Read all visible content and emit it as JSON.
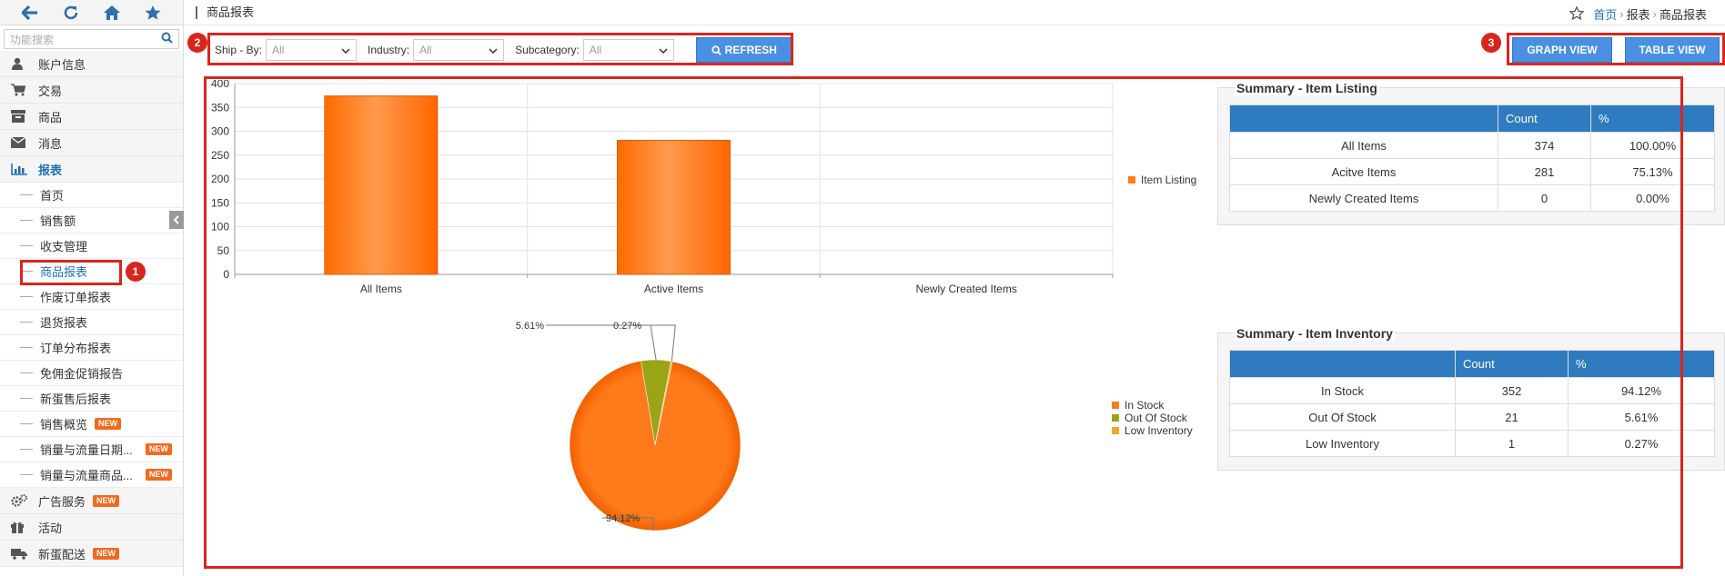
{
  "sidebar": {
    "search_placeholder": "功能搜索",
    "menu": [
      {
        "label": "账户信息",
        "icon": "user-icon"
      },
      {
        "label": "交易",
        "icon": "cart-icon"
      },
      {
        "label": "商品",
        "icon": "archive-icon"
      },
      {
        "label": "消息",
        "icon": "envelope-icon"
      },
      {
        "label": "报表",
        "icon": "bar-chart-icon"
      }
    ],
    "submenu": [
      {
        "label": "首页"
      },
      {
        "label": "销售额"
      },
      {
        "label": "收支管理"
      },
      {
        "label": "商品报表"
      },
      {
        "label": "作废订单报表"
      },
      {
        "label": "退货报表"
      },
      {
        "label": "订单分布报表"
      },
      {
        "label": "免佣金促销报告"
      },
      {
        "label": "新蛋售后报表"
      },
      {
        "label": "销售概览",
        "badge": "NEW"
      },
      {
        "label": "销量与流量日期...",
        "badge": "NEW"
      },
      {
        "label": "销量与流量商品...",
        "badge": "NEW"
      }
    ],
    "menu2": [
      {
        "label": "广告服务",
        "icon": "gears-icon",
        "badge": "NEW"
      },
      {
        "label": "活动",
        "icon": "gift-icon"
      },
      {
        "label": "新蛋配送",
        "icon": "truck-icon",
        "badge": "NEW"
      }
    ]
  },
  "header": {
    "title": "商品报表",
    "breadcrumb": {
      "home": "首页",
      "parent": "报表",
      "current": "商品报表"
    }
  },
  "filters": {
    "ship_by_label": "Ship - By:",
    "ship_by_value": "All",
    "industry_label": "Industry:",
    "industry_value": "All",
    "subcategory_label": "Subcategory:",
    "subcategory_value": "All",
    "refresh_label": "REFRESH"
  },
  "view_buttons": {
    "graph": "GRAPH VIEW",
    "table": "TABLE VIEW"
  },
  "callouts": [
    "1",
    "2",
    "3"
  ],
  "chart_data": [
    {
      "type": "bar",
      "categories": [
        "All Items",
        "Active Items",
        "Newly Created Items"
      ],
      "series": [
        {
          "name": "Item Listing",
          "values": [
            374,
            281,
            0
          ],
          "color": "#ff7a1a"
        }
      ],
      "ylim": [
        0,
        400
      ],
      "yticks": [
        "0",
        "50",
        "100",
        "150",
        "200",
        "250",
        "300",
        "350",
        "400"
      ],
      "grid": true,
      "legend_position": "right"
    },
    {
      "type": "pie",
      "slices": [
        {
          "name": "In Stock",
          "value": 94.12,
          "label": "94.12%",
          "color": "#ff7a1a"
        },
        {
          "name": "Out Of Stock",
          "value": 5.61,
          "label": "5.61%",
          "color": "#9aa515"
        },
        {
          "name": "Low Inventory",
          "value": 0.27,
          "label": "0.27%",
          "color": "#f5a623"
        }
      ],
      "legend_position": "right"
    }
  ],
  "summary_listing": {
    "title": "Summary - Item Listing",
    "headers": [
      "",
      "Count",
      "%"
    ],
    "rows": [
      [
        "All Items",
        "374",
        "100.00%"
      ],
      [
        "Acitve Items",
        "281",
        "75.13%"
      ],
      [
        "Newly Created Items",
        "0",
        "0.00%"
      ]
    ]
  },
  "summary_inventory": {
    "title": "Summary - Item Inventory",
    "headers": [
      "",
      "Count",
      "%"
    ],
    "rows": [
      [
        "In Stock",
        "352",
        "94.12%"
      ],
      [
        "Out Of Stock",
        "21",
        "5.61%"
      ],
      [
        "Low Inventory",
        "1",
        "0.27%"
      ]
    ]
  },
  "colors": {
    "accent": "#1e6fb5",
    "button": "#4a90e2",
    "bar": "#ff7a1a",
    "callout": "#d9261c",
    "table_header": "#2f7bbf"
  }
}
